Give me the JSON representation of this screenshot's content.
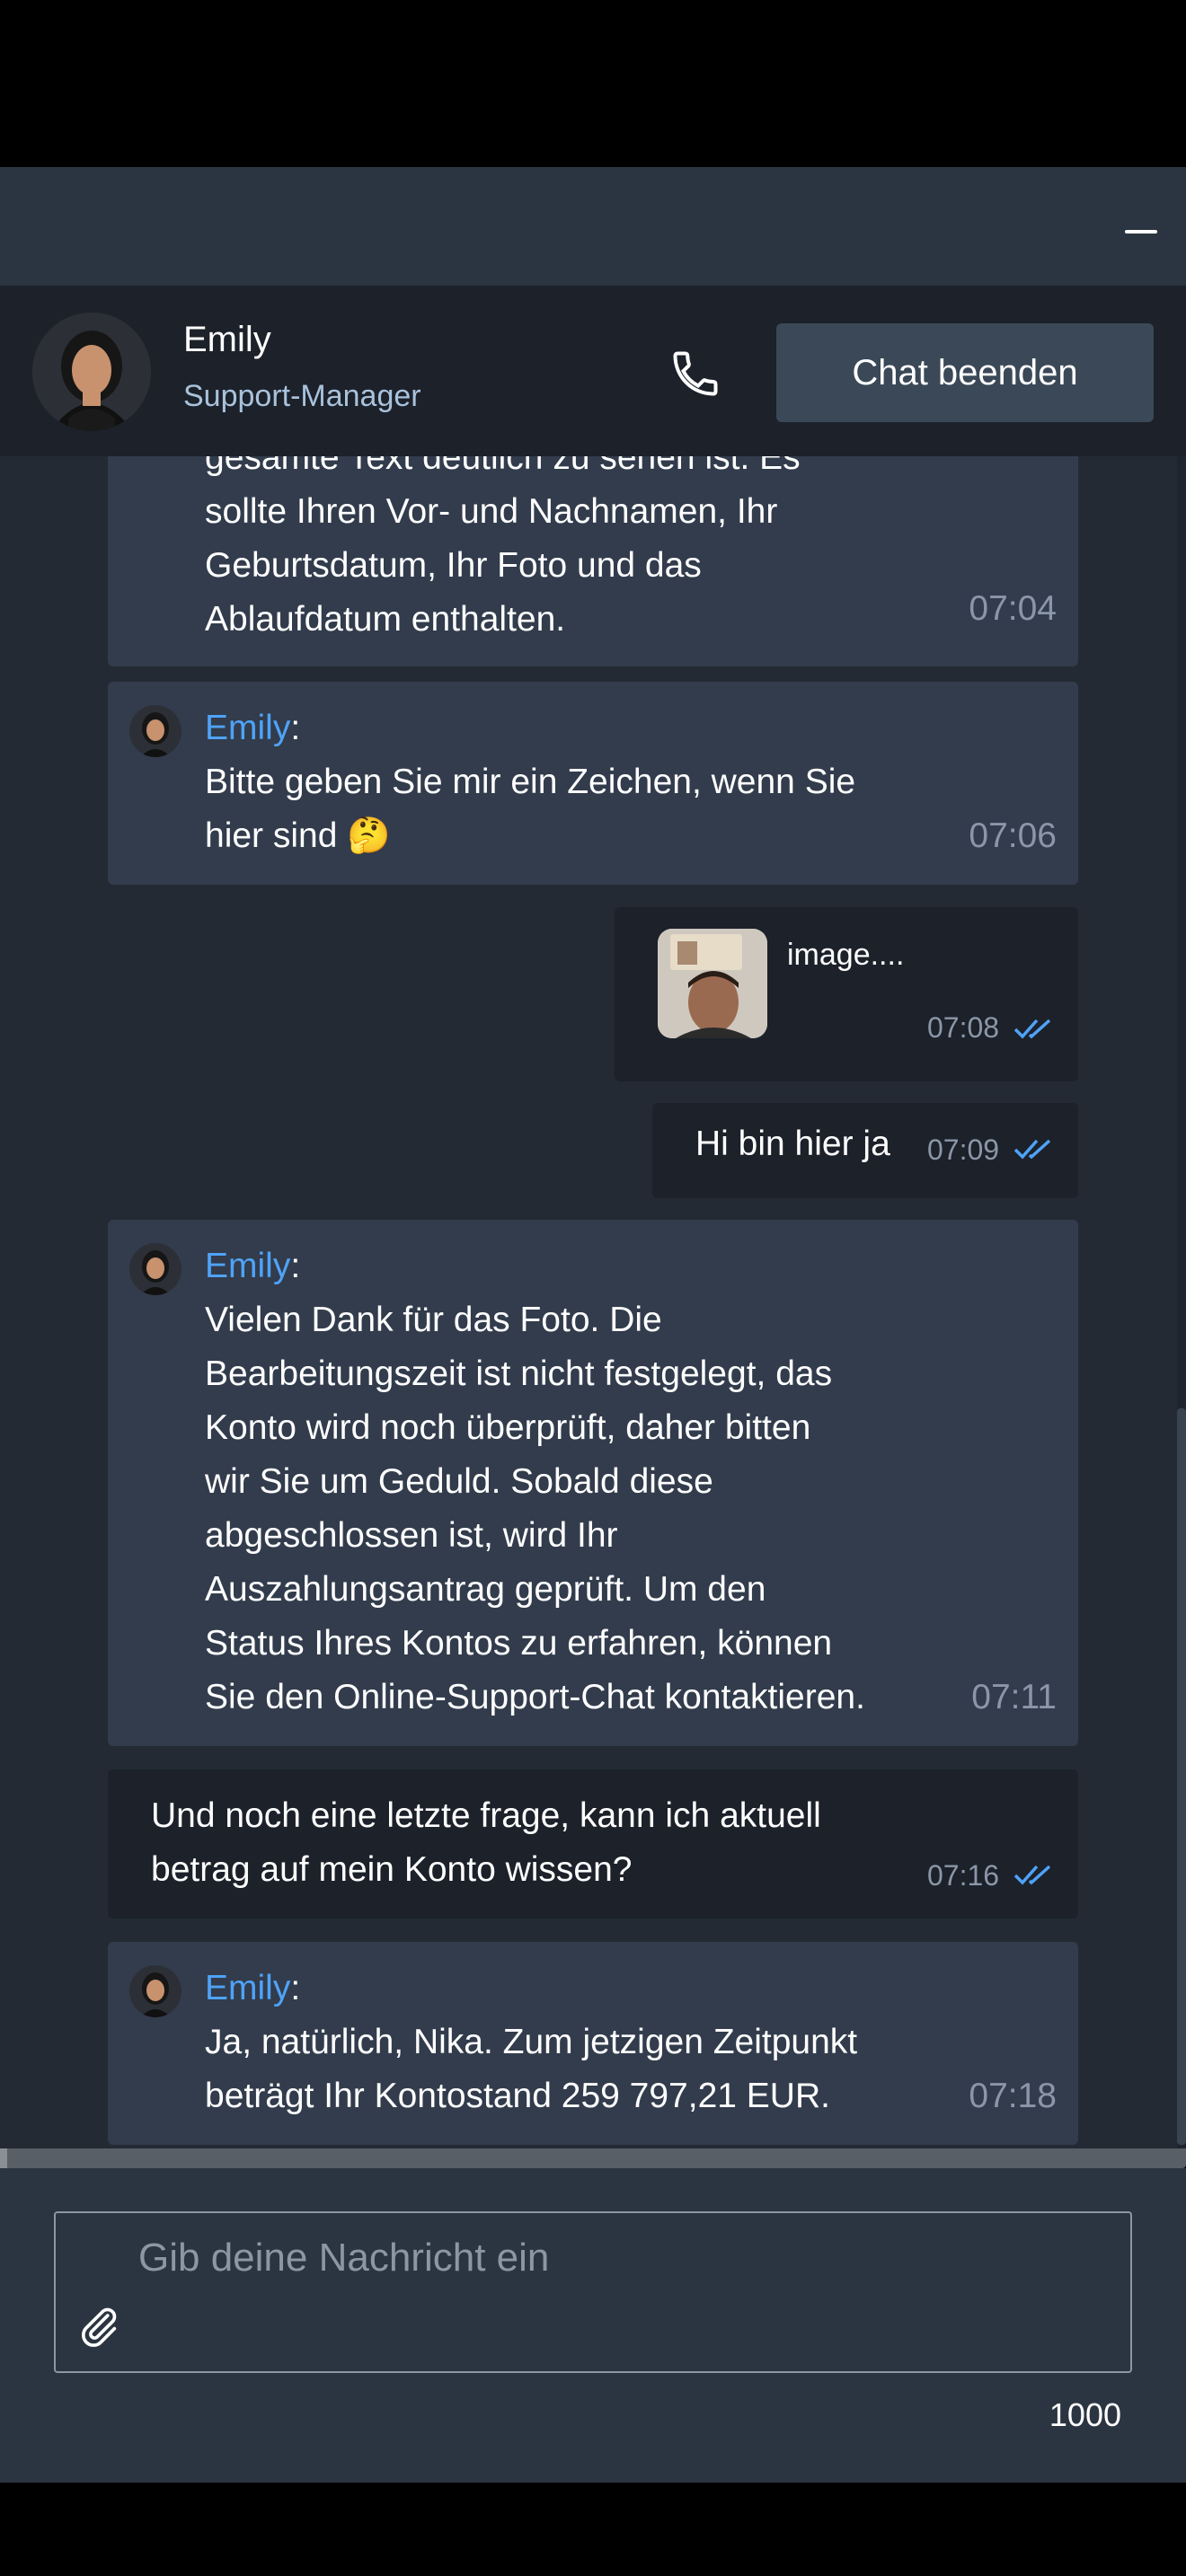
{
  "window": {
    "minimize_label": "minimize"
  },
  "header": {
    "agent_name": "Emily",
    "agent_role": "Support-Manager",
    "end_chat_label": "Chat beenden"
  },
  "messages": [
    {
      "type": "in",
      "text": "gesamte Text deutlich zu sehen ist. Es\nsollte Ihren Vor- und Nachnamen, Ihr\nGeburtsdatum, Ihr Foto und das\nAblaufdatum enthalten.",
      "time": "07:04"
    },
    {
      "type": "in",
      "sender": "Emily",
      "text": "Bitte geben Sie mir ein Zeichen, wenn Sie\nhier sind 🤔",
      "time": "07:06"
    },
    {
      "type": "out-image",
      "file_label": "image....",
      "time": "07:08"
    },
    {
      "type": "out",
      "text": "Hi bin hier ja",
      "time": "07:09"
    },
    {
      "type": "in",
      "sender": "Emily",
      "text": "Vielen Dank für das Foto. Die\nBearbeitungszeit ist nicht festgelegt, das\nKonto wird noch überprüft, daher bitten\nwir Sie um Geduld. Sobald diese\nabgeschlossen ist, wird Ihr\nAuszahlungsantrag geprüft. Um den\nStatus Ihres Kontos zu erfahren, können\nSie den Online-Support-Chat kontaktieren.",
      "time": "07:11"
    },
    {
      "type": "out",
      "text": "Und noch eine letzte frage, kann ich aktuell\nbetrag auf mein Konto wissen?",
      "time": "07:16"
    },
    {
      "type": "in",
      "sender": "Emily",
      "text": "Ja, natürlich, Nika. Zum jetzigen Zeitpunkt\nbeträgt Ihr Kontostand 259 797,21 EUR.",
      "time": "07:18"
    }
  ],
  "composer": {
    "placeholder": "Gib deine Nachricht ein",
    "char_count": "1000"
  },
  "colors": {
    "accent_blue": "#4fa3f7",
    "incoming_bubble": "#323c4c",
    "outgoing_bubble": "#1c212a",
    "chat_bg": "#232a34"
  },
  "icons": {
    "phone": "phone-icon",
    "attach": "paperclip-icon",
    "read": "double-check-icon"
  }
}
